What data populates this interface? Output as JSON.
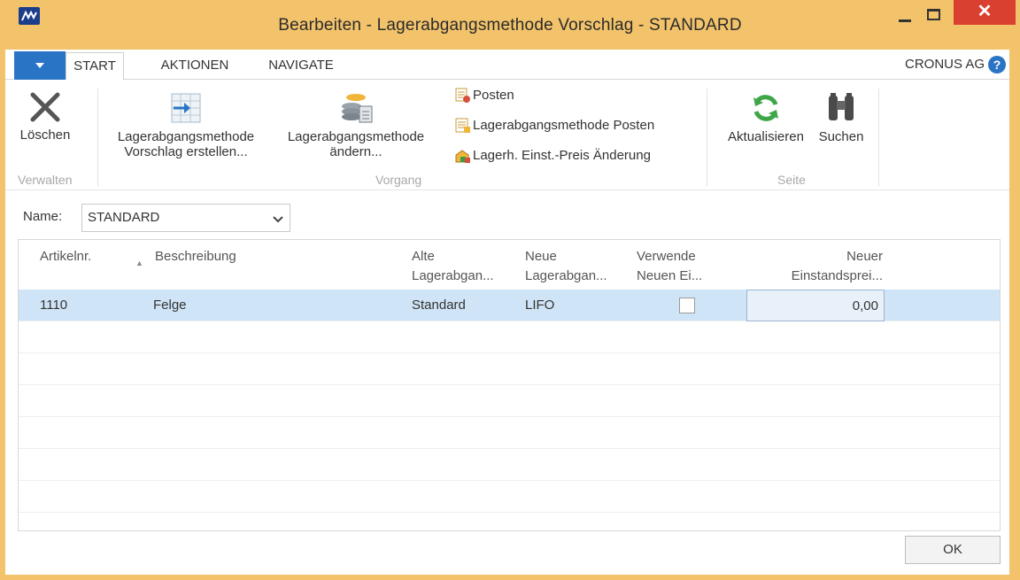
{
  "window": {
    "title": "Bearbeiten - Lagerabgangsmethode Vorschlag - STANDARD",
    "close_glyph": "✕"
  },
  "tabs": [
    {
      "label": "START",
      "active": true
    },
    {
      "label": "AKTIONEN",
      "active": false
    },
    {
      "label": "NAVIGATE",
      "active": false
    }
  ],
  "company": "CRONUS AG",
  "help_glyph": "?",
  "ribbon": {
    "delete_label": "Löschen",
    "create_label_1": "Lagerabgangsmethode",
    "create_label_2": "Vorschlag erstellen...",
    "change_label_1": "Lagerabgangsmethode",
    "change_label_2": "ändern...",
    "links": [
      "Posten",
      "Lagerabgangsmethode Posten",
      "Lagerh. Einst.-Preis Änderung"
    ],
    "refresh_label": "Aktualisieren",
    "search_label": "Suchen",
    "groups": {
      "manage": "Verwalten",
      "process": "Vorgang",
      "page": "Seite"
    }
  },
  "filter": {
    "label": "Name:",
    "value": "STANDARD"
  },
  "table": {
    "columns": [
      {
        "line1": "Artikelnr.",
        "line2": ""
      },
      {
        "line1": "Beschreibung",
        "line2": ""
      },
      {
        "line1": "Alte",
        "line2": "Lagerabgan..."
      },
      {
        "line1": "Neue",
        "line2": "Lagerabgan..."
      },
      {
        "line1": "Verwende",
        "line2": "Neuen Ei..."
      },
      {
        "line1": "Neuer",
        "line2": "Einstandsprei..."
      }
    ],
    "rows": [
      {
        "item_no": "1110",
        "description": "Felge",
        "old_method": "Standard",
        "new_method": "LIFO",
        "use_new": false,
        "new_cost": "0,00"
      }
    ]
  },
  "ok_label": "OK",
  "colors": {
    "titlebar": "#f2c36b",
    "accent": "#2a74c6",
    "close": "#d9402f",
    "selected_row": "#cfe4f6"
  }
}
